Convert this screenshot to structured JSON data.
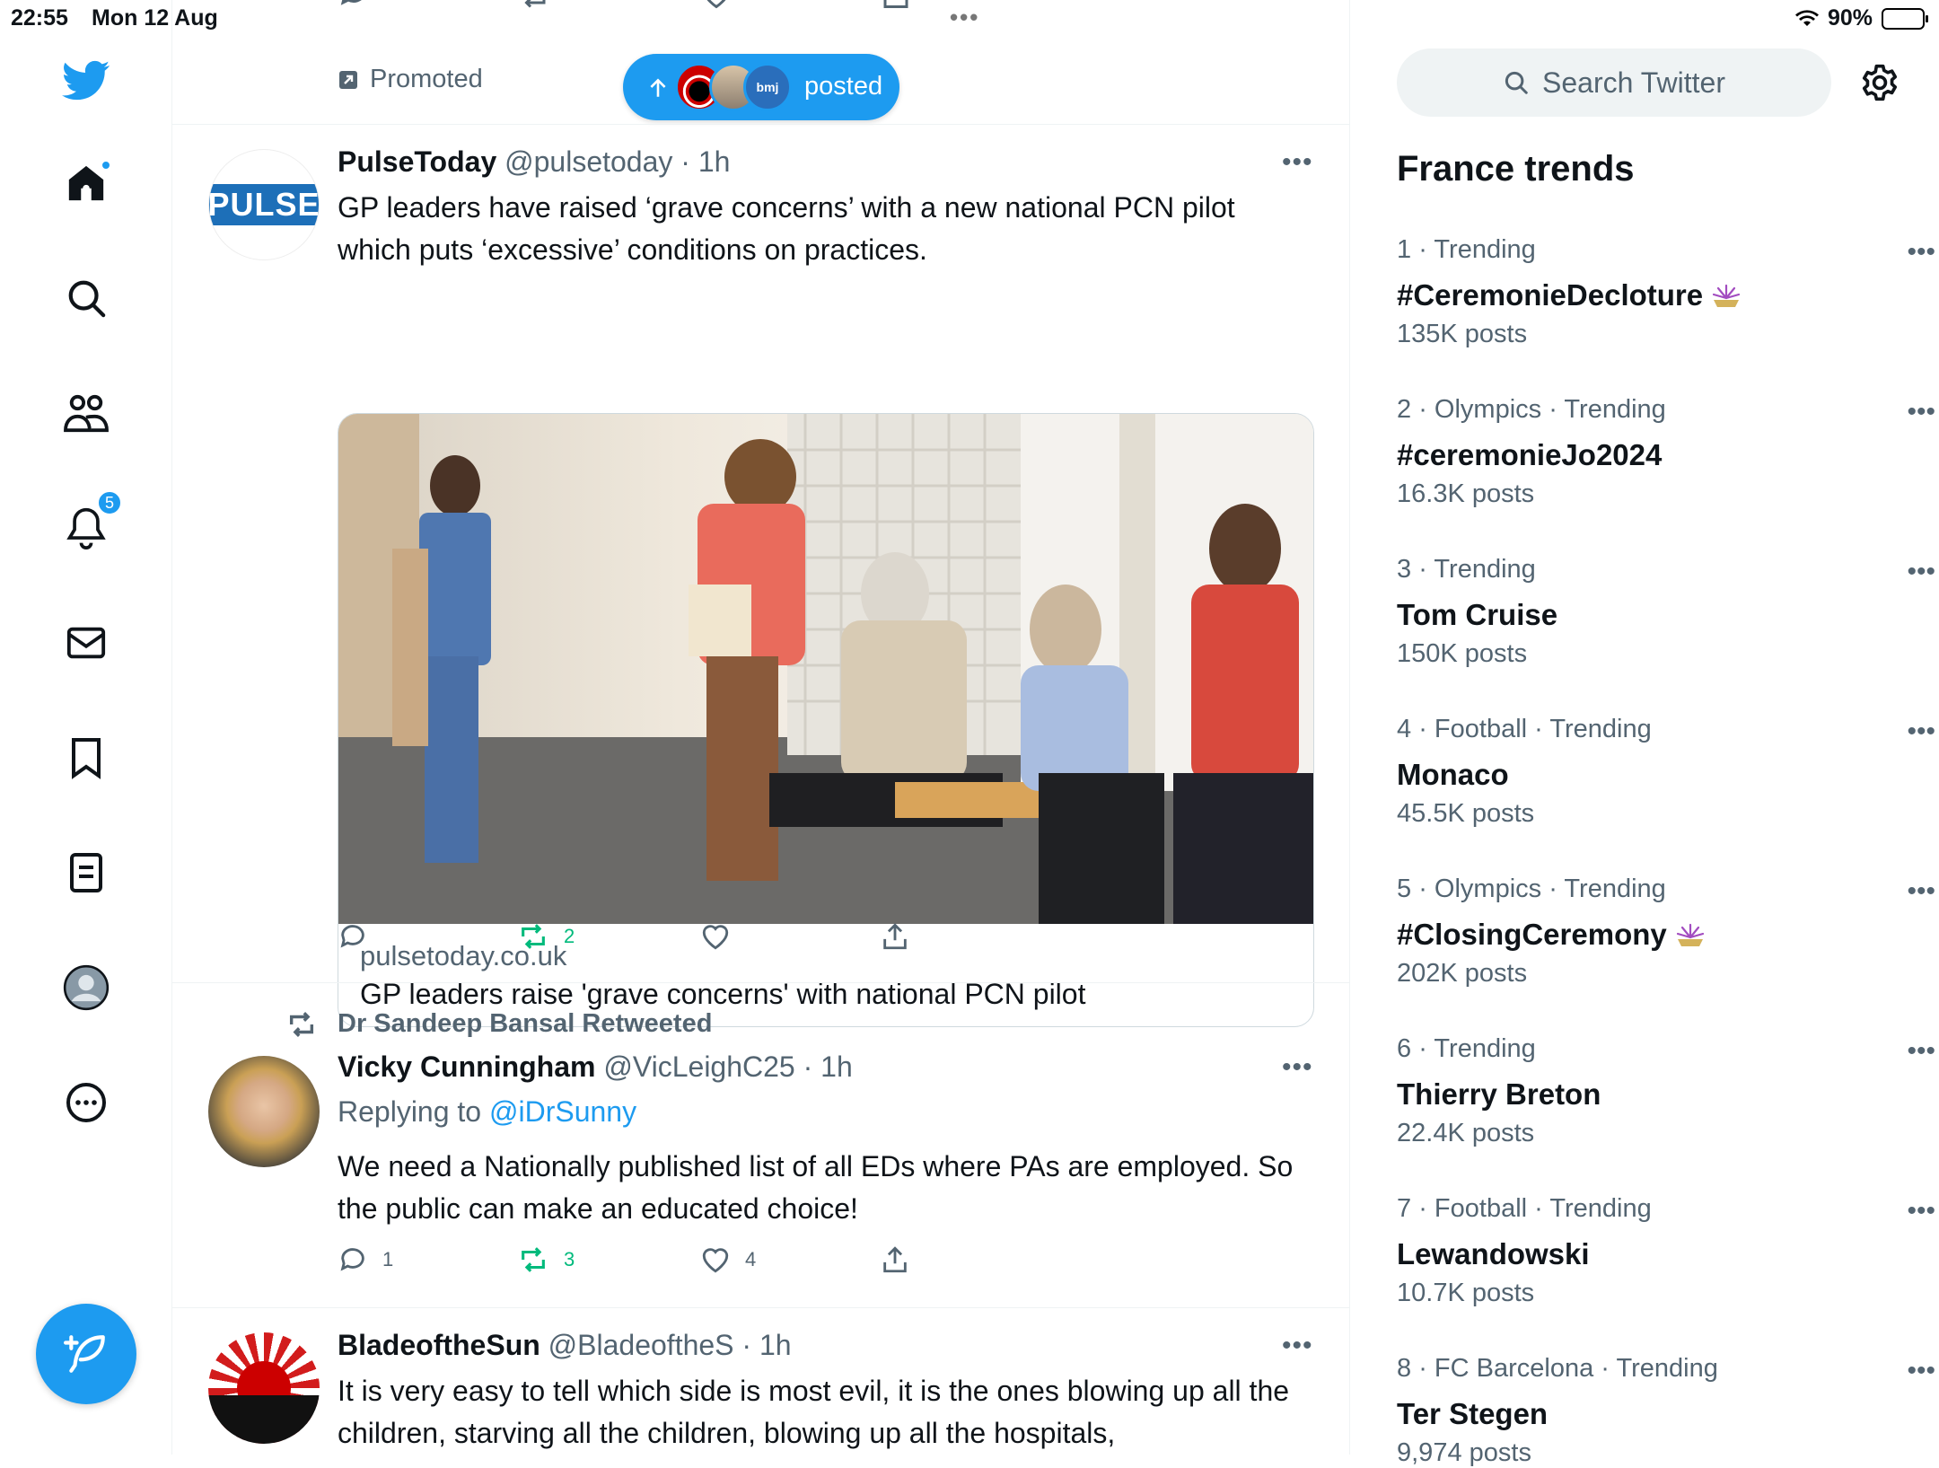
{
  "status_bar": {
    "time": "22:55",
    "date": "Mon 12 Aug",
    "battery": "90%"
  },
  "sidebar": {
    "notification_count": "5",
    "items": [
      {
        "name": "home"
      },
      {
        "name": "explore"
      },
      {
        "name": "communities"
      },
      {
        "name": "notifications"
      },
      {
        "name": "messages"
      },
      {
        "name": "bookmarks"
      },
      {
        "name": "lists"
      },
      {
        "name": "profile"
      },
      {
        "name": "more"
      }
    ]
  },
  "timeline": {
    "promoted_label": "Promoted",
    "new_posts_pill": {
      "label": "posted",
      "avatar_text": "bmj"
    },
    "tweets": [
      {
        "name": "PulseToday",
        "handle": "@pulsetoday",
        "time": "· 1h",
        "avatar_text": "PULSE",
        "text": "GP leaders have raised ‘grave concerns’ with a new national PCN pilot which puts ‘excessive’ conditions on practices.",
        "card": {
          "domain": "pulsetoday.co.uk",
          "title": "GP leaders raise 'grave concerns' with national PCN pilot"
        },
        "retweets": "2"
      },
      {
        "retweeted_by": "Dr Sandeep Bansal Retweeted",
        "name": "Vicky Cunningham",
        "handle": "@VicLeighC25",
        "time": "· 1h",
        "replying_prefix": "Replying to",
        "replying_to": "@iDrSunny",
        "text": "We need a Nationally published list of all EDs where PAs are employed. So the public can make an educated choice!",
        "replies": "1",
        "retweets": "3",
        "likes": "4"
      },
      {
        "name": "BladeoftheSun",
        "handle": "@BladeoftheS",
        "time": "· 1h",
        "text": "It is very easy to tell which side is most evil, it is the ones blowing up all the children, starving all the children, blowing up all the hospitals,"
      }
    ]
  },
  "right": {
    "search_placeholder": "Search Twitter",
    "trends_title": "France trends",
    "trends": [
      {
        "rank": "1",
        "category": "· Trending",
        "name": "#CeremonieDecloture",
        "posts": "135K posts",
        "emoji": true
      },
      {
        "rank": "2",
        "category": "· Olympics · Trending",
        "name": "#ceremonieJo2024",
        "posts": "16.3K posts",
        "emoji": false
      },
      {
        "rank": "3",
        "category": "· Trending",
        "name": "Tom Cruise",
        "posts": "150K posts",
        "emoji": false
      },
      {
        "rank": "4",
        "category": "· Football · Trending",
        "name": "Monaco",
        "posts": "45.5K posts",
        "emoji": false
      },
      {
        "rank": "5",
        "category": "· Olympics · Trending",
        "name": "#ClosingCeremony",
        "posts": "202K posts",
        "emoji": true
      },
      {
        "rank": "6",
        "category": "· Trending",
        "name": "Thierry Breton",
        "posts": "22.4K posts",
        "emoji": false
      },
      {
        "rank": "7",
        "category": "· Football · Trending",
        "name": "Lewandowski",
        "posts": "10.7K posts",
        "emoji": false
      },
      {
        "rank": "8",
        "category": "· FC Barcelona · Trending",
        "name": "Ter Stegen",
        "posts": "9,974 posts",
        "emoji": false
      }
    ]
  },
  "colors": {
    "accent": "#1d9bf0",
    "retweet_green": "#00ba7c",
    "secondary_text": "#536471"
  }
}
